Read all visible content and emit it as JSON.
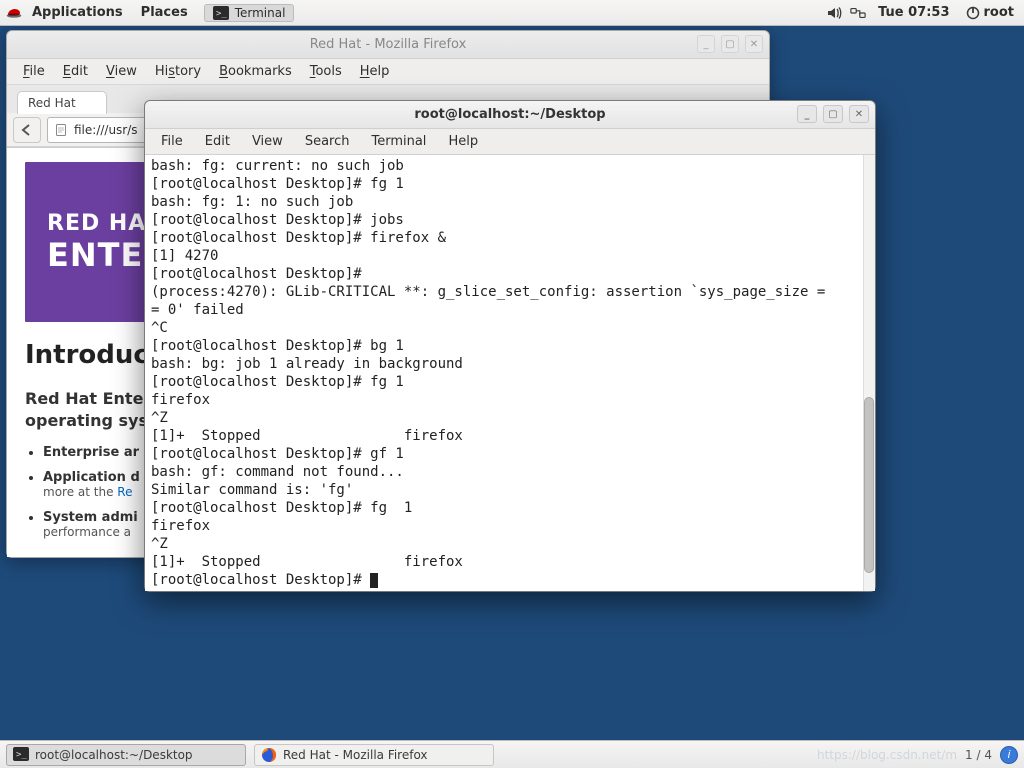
{
  "top_panel": {
    "applications": "Applications",
    "places": "Places",
    "terminal_task": "Terminal",
    "clock": "Tue 07:53",
    "user": "root"
  },
  "firefox": {
    "title": "Red Hat - Mozilla Firefox",
    "menus": {
      "file": "File",
      "edit": "Edit",
      "view": "View",
      "history": "History",
      "bookmarks": "Bookmarks",
      "tools": "Tools",
      "help": "Help"
    },
    "tab": "Red Hat",
    "url": "file:///usr/s",
    "banner": {
      "line1": "RED HAT",
      "line2": "ENTER"
    },
    "h1": "Introducin",
    "sub1": "Red Hat Enter",
    "sub2": "operating syst",
    "bullets": {
      "b1": "Enterprise ar",
      "b2": "Application d",
      "b2_sub_a": "more at the ",
      "b2_sub_link": "Re",
      "b3": "System admi",
      "b3_sub": "performance a"
    }
  },
  "terminal": {
    "title": "root@localhost:~/Desktop",
    "menus": {
      "file": "File",
      "edit": "Edit",
      "view": "View",
      "search": "Search",
      "terminal": "Terminal",
      "help": "Help"
    },
    "lines": [
      "bash: fg: current: no such job",
      "[root@localhost Desktop]# fg 1",
      "bash: fg: 1: no such job",
      "[root@localhost Desktop]# jobs",
      "[root@localhost Desktop]# firefox &",
      "[1] 4270",
      "[root@localhost Desktop]# ",
      "(process:4270): GLib-CRITICAL **: g_slice_set_config: assertion `sys_page_size =",
      "= 0' failed",
      "^C",
      "[root@localhost Desktop]# bg 1",
      "bash: bg: job 1 already in background",
      "[root@localhost Desktop]# fg 1",
      "firefox",
      "^Z",
      "[1]+  Stopped                 firefox",
      "[root@localhost Desktop]# gf 1",
      "bash: gf: command not found...",
      "Similar command is: 'fg'",
      "[root@localhost Desktop]# fg  1",
      "firefox",
      "^Z",
      "[1]+  Stopped                 firefox"
    ],
    "prompt": "[root@localhost Desktop]# "
  },
  "bottom_panel": {
    "task1": "root@localhost:~/Desktop",
    "task2": "Red Hat - Mozilla Firefox",
    "watermark": "https://blog.csdn.net/m",
    "pager": "1 / 4"
  }
}
